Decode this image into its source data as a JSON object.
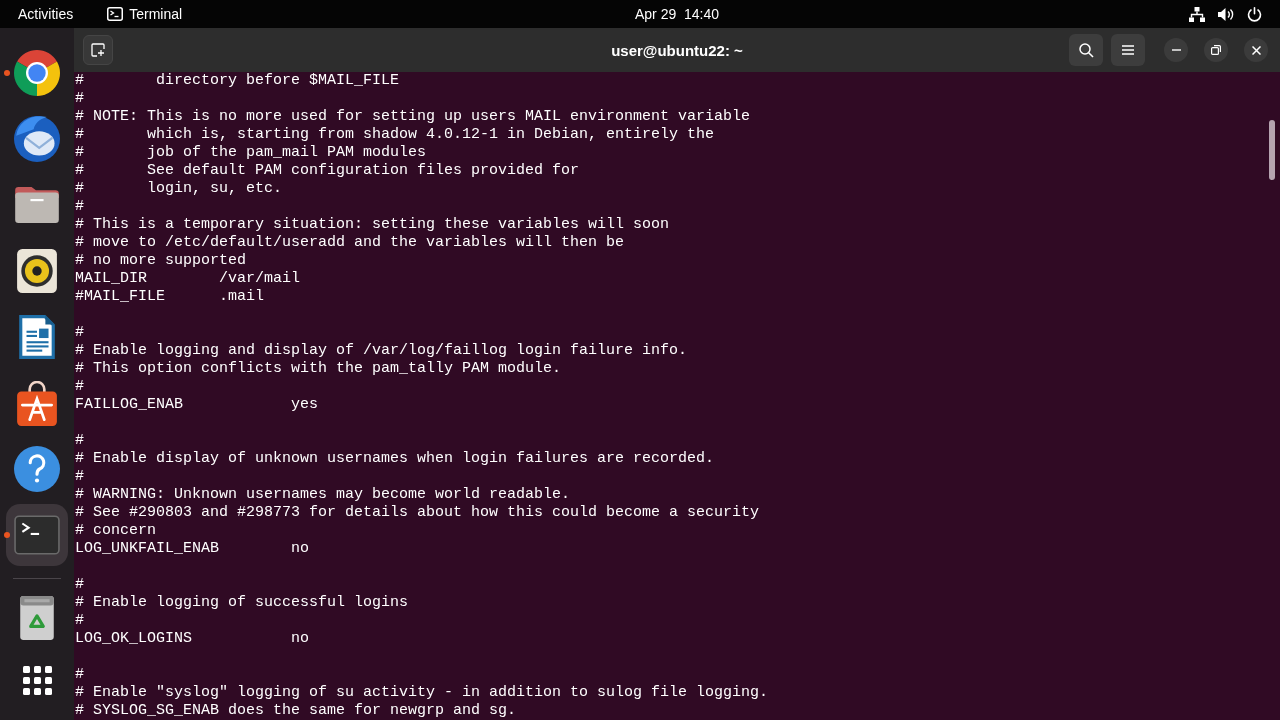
{
  "top_bar": {
    "activities": "Activities",
    "app_menu": "Terminal",
    "clock": "Apr 29  14:40"
  },
  "dock": {
    "apps": [
      {
        "kind": "browser",
        "running": true,
        "selected": false
      },
      {
        "kind": "mail",
        "running": false,
        "selected": false
      },
      {
        "kind": "files",
        "running": false,
        "selected": false
      },
      {
        "kind": "music",
        "running": false,
        "selected": false
      },
      {
        "kind": "writer",
        "running": false,
        "selected": false
      },
      {
        "kind": "store",
        "running": false,
        "selected": false
      },
      {
        "kind": "help",
        "running": false,
        "selected": false
      },
      {
        "kind": "terminal",
        "running": true,
        "selected": true
      }
    ],
    "after_separator": [
      {
        "kind": "trash",
        "running": false,
        "selected": false
      }
    ]
  },
  "terminal": {
    "title": "user@ubuntu22: ~",
    "blocks": [
      [
        "#        directory before $MAIL_FILE",
        "#",
        "# NOTE: This is no more used for setting up users MAIL environment variable",
        "#       which is, starting from shadow 4.0.12-1 in Debian, entirely the",
        "#       job of the pam_mail PAM modules",
        "#       See default PAM configuration files provided for",
        "#       login, su, etc.",
        "#",
        "# This is a temporary situation: setting these variables will soon",
        "# move to /etc/default/useradd and the variables will then be",
        "# no more supported",
        "MAIL_DIR        /var/mail",
        "#MAIL_FILE      .mail"
      ],
      [
        "#",
        "# Enable logging and display of /var/log/faillog login failure info.",
        "# This option conflicts with the pam_tally PAM module.",
        "#",
        "FAILLOG_ENAB            yes"
      ],
      [
        "#",
        "# Enable display of unknown usernames when login failures are recorded.",
        "#",
        "# WARNING: Unknown usernames may become world readable.",
        "# See #290803 and #298773 for details about how this could become a security",
        "# concern",
        "LOG_UNKFAIL_ENAB        no"
      ],
      [
        "#",
        "# Enable logging of successful logins",
        "#",
        "LOG_OK_LOGINS           no"
      ],
      [
        "#",
        "# Enable \"syslog\" logging of su activity - in addition to sulog file logging.",
        "# SYSLOG_SG_ENAB does the same for newgrp and sg."
      ]
    ]
  }
}
